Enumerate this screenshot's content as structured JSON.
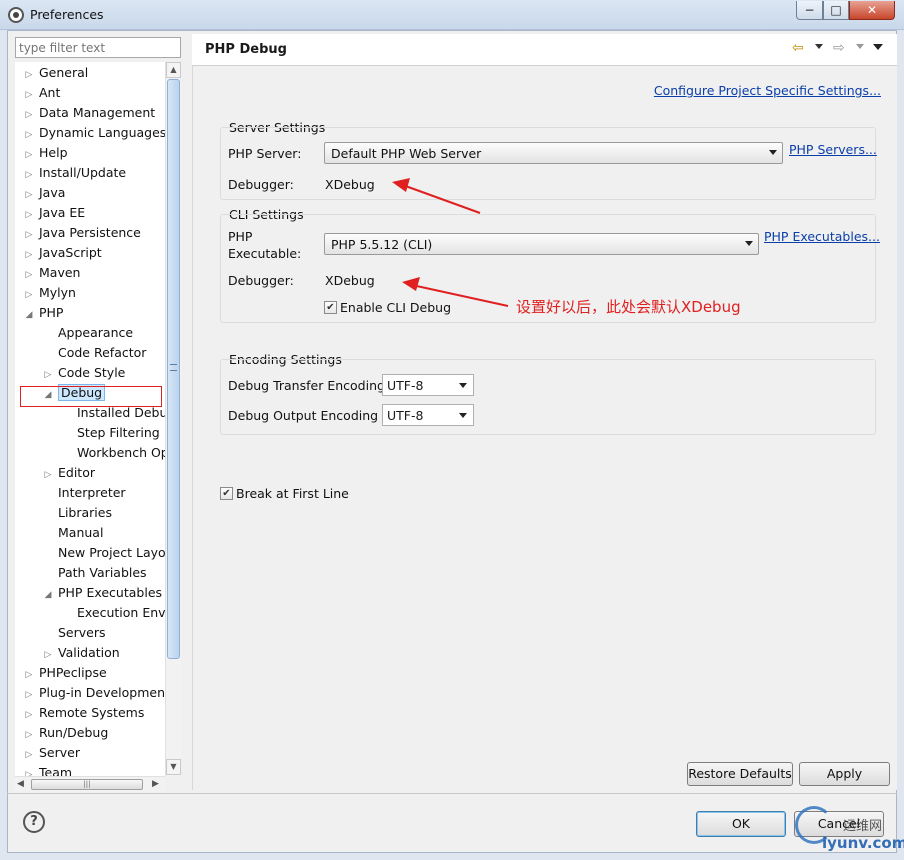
{
  "window": {
    "title": "Preferences",
    "minimize": "−",
    "maximize": "□",
    "close": "✕"
  },
  "filter": {
    "placeholder": "type filter text"
  },
  "tree": [
    {
      "label": "General",
      "indent": 0,
      "tw": "▷"
    },
    {
      "label": "Ant",
      "indent": 0,
      "tw": "▷"
    },
    {
      "label": "Data Management",
      "indent": 0,
      "tw": "▷"
    },
    {
      "label": "Dynamic Languages",
      "indent": 0,
      "tw": "▷"
    },
    {
      "label": "Help",
      "indent": 0,
      "tw": "▷"
    },
    {
      "label": "Install/Update",
      "indent": 0,
      "tw": "▷"
    },
    {
      "label": "Java",
      "indent": 0,
      "tw": "▷"
    },
    {
      "label": "Java EE",
      "indent": 0,
      "tw": "▷"
    },
    {
      "label": "Java Persistence",
      "indent": 0,
      "tw": "▷"
    },
    {
      "label": "JavaScript",
      "indent": 0,
      "tw": "▷"
    },
    {
      "label": "Maven",
      "indent": 0,
      "tw": "▷"
    },
    {
      "label": "Mylyn",
      "indent": 0,
      "tw": "▷"
    },
    {
      "label": "PHP",
      "indent": 0,
      "tw": "◢"
    },
    {
      "label": "Appearance",
      "indent": 1,
      "tw": ""
    },
    {
      "label": "Code Refactor",
      "indent": 1,
      "tw": ""
    },
    {
      "label": "Code Style",
      "indent": 1,
      "tw": "▷"
    },
    {
      "label": "Debug",
      "indent": 1,
      "tw": "◢",
      "selected": true
    },
    {
      "label": "Installed Debuggers",
      "indent": 2,
      "tw": ""
    },
    {
      "label": "Step Filtering",
      "indent": 2,
      "tw": ""
    },
    {
      "label": "Workbench Options",
      "indent": 2,
      "tw": ""
    },
    {
      "label": "Editor",
      "indent": 1,
      "tw": "▷"
    },
    {
      "label": "Interpreter",
      "indent": 1,
      "tw": ""
    },
    {
      "label": "Libraries",
      "indent": 1,
      "tw": ""
    },
    {
      "label": "Manual",
      "indent": 1,
      "tw": ""
    },
    {
      "label": "New Project Layout",
      "indent": 1,
      "tw": ""
    },
    {
      "label": "Path Variables",
      "indent": 1,
      "tw": ""
    },
    {
      "label": "PHP Executables",
      "indent": 1,
      "tw": "◢"
    },
    {
      "label": "Execution Environments",
      "indent": 2,
      "tw": ""
    },
    {
      "label": "Servers",
      "indent": 1,
      "tw": ""
    },
    {
      "label": "Validation",
      "indent": 1,
      "tw": "▷"
    },
    {
      "label": "PHPeclipse",
      "indent": 0,
      "tw": "▷"
    },
    {
      "label": "Plug-in Development",
      "indent": 0,
      "tw": "▷"
    },
    {
      "label": "Remote Systems",
      "indent": 0,
      "tw": "▷"
    },
    {
      "label": "Run/Debug",
      "indent": 0,
      "tw": "▷"
    },
    {
      "label": "Server",
      "indent": 0,
      "tw": "▷"
    },
    {
      "label": "Team",
      "indent": 0,
      "tw": "▷"
    }
  ],
  "page": {
    "title": "PHP Debug",
    "configure_link": "Configure Project Specific Settings...",
    "server_settings": {
      "label": "Server Settings",
      "php_server_label": "PHP Server:",
      "php_server_value": "Default PHP Web Server",
      "php_servers_link": "PHP Servers...",
      "debugger_label": "Debugger:",
      "debugger_value": "XDebug"
    },
    "cli_settings": {
      "label": "CLI Settings",
      "php_label": "PHP",
      "executable_label": "Executable:",
      "executable_value": "PHP 5.5.12 (CLI)",
      "executables_link": "PHP Executables...",
      "debugger_label": "Debugger:",
      "debugger_value": "XDebug",
      "enable_cli_debug": "Enable CLI Debug",
      "enable_cli_debug_checked": true
    },
    "encoding_settings": {
      "label": "Encoding Settings",
      "transfer_label": "Debug Transfer Encoding",
      "transfer_value": "UTF-8",
      "output_label": "Debug Output Encoding",
      "output_value": "UTF-8"
    },
    "break_first_line": "Break at First Line",
    "break_first_line_checked": true,
    "annotation": "设置好以后，此处会默认XDebug",
    "restore_defaults": "Restore Defaults",
    "apply": "Apply"
  },
  "footer": {
    "help": "?",
    "ok": "OK",
    "cancel": "Cancel"
  },
  "watermark": {
    "line1": "运维网",
    "line2": "iyunv.com"
  },
  "colors": {
    "annotation": "#e02020",
    "link": "#0a3ea8",
    "selection": "#cde8ff"
  }
}
